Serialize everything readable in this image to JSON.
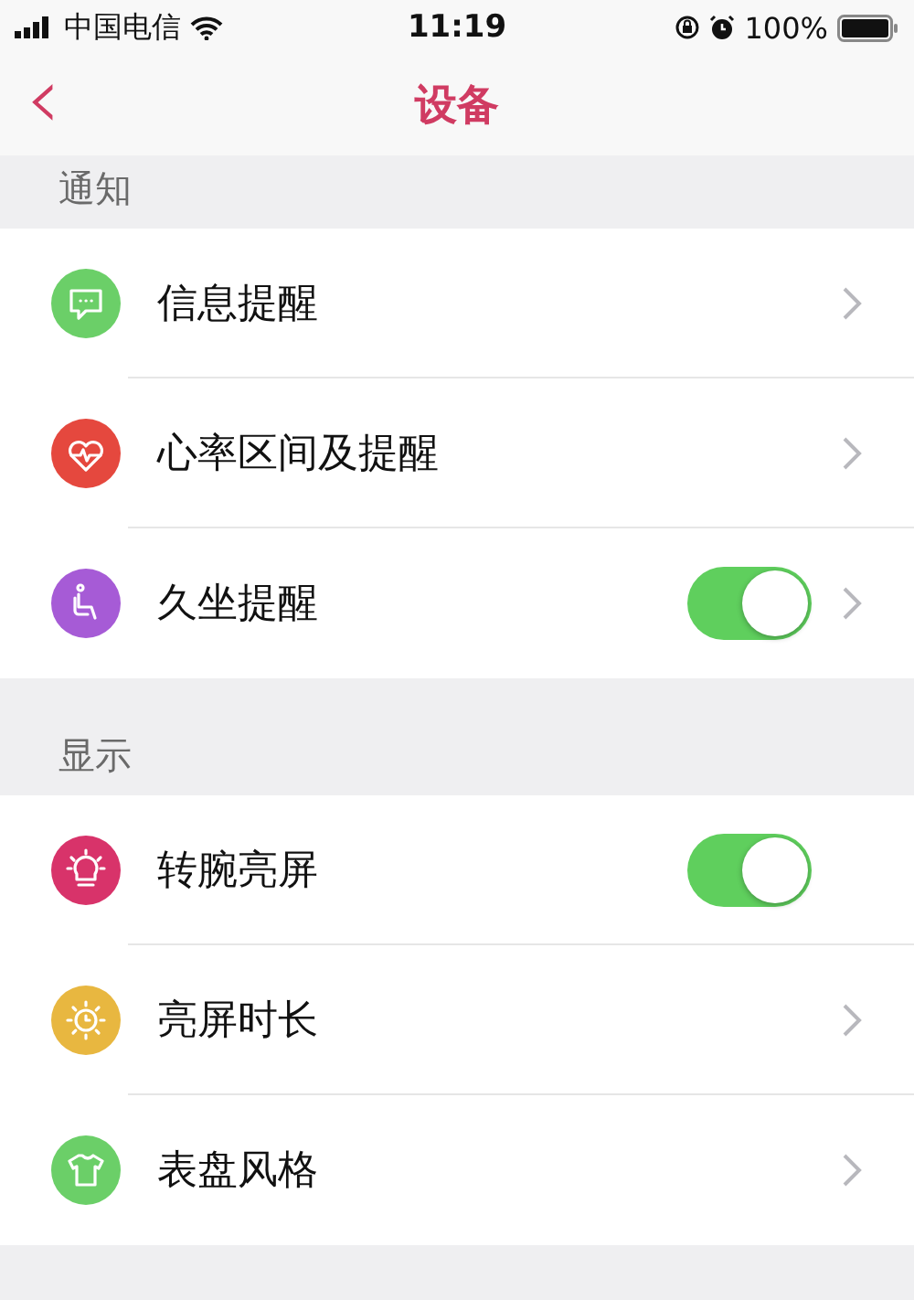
{
  "status_bar": {
    "carrier": "中国电信",
    "time": "11:19",
    "battery": "100%"
  },
  "nav": {
    "back": "‹",
    "title": "设备"
  },
  "sections": [
    {
      "title": "通知",
      "items": [
        {
          "label": "信息提醒",
          "color": "#6bcf68",
          "chevron": true
        },
        {
          "label": "心率区间及提醒",
          "color": "#e5483e",
          "chevron": true
        },
        {
          "label": "久坐提醒",
          "color": "#a65bd6",
          "chevron": true,
          "toggle": {
            "on": true
          }
        }
      ]
    },
    {
      "title": "显示",
      "items": [
        {
          "label": "转腕亮屏",
          "color": "#d8336a",
          "chevron": false,
          "toggle": {
            "on": true
          }
        },
        {
          "label": "亮屏时长",
          "color": "#e8b740",
          "chevron": true
        },
        {
          "label": "表盘风格",
          "color": "#6bcf68",
          "chevron": true
        }
      ]
    }
  ]
}
